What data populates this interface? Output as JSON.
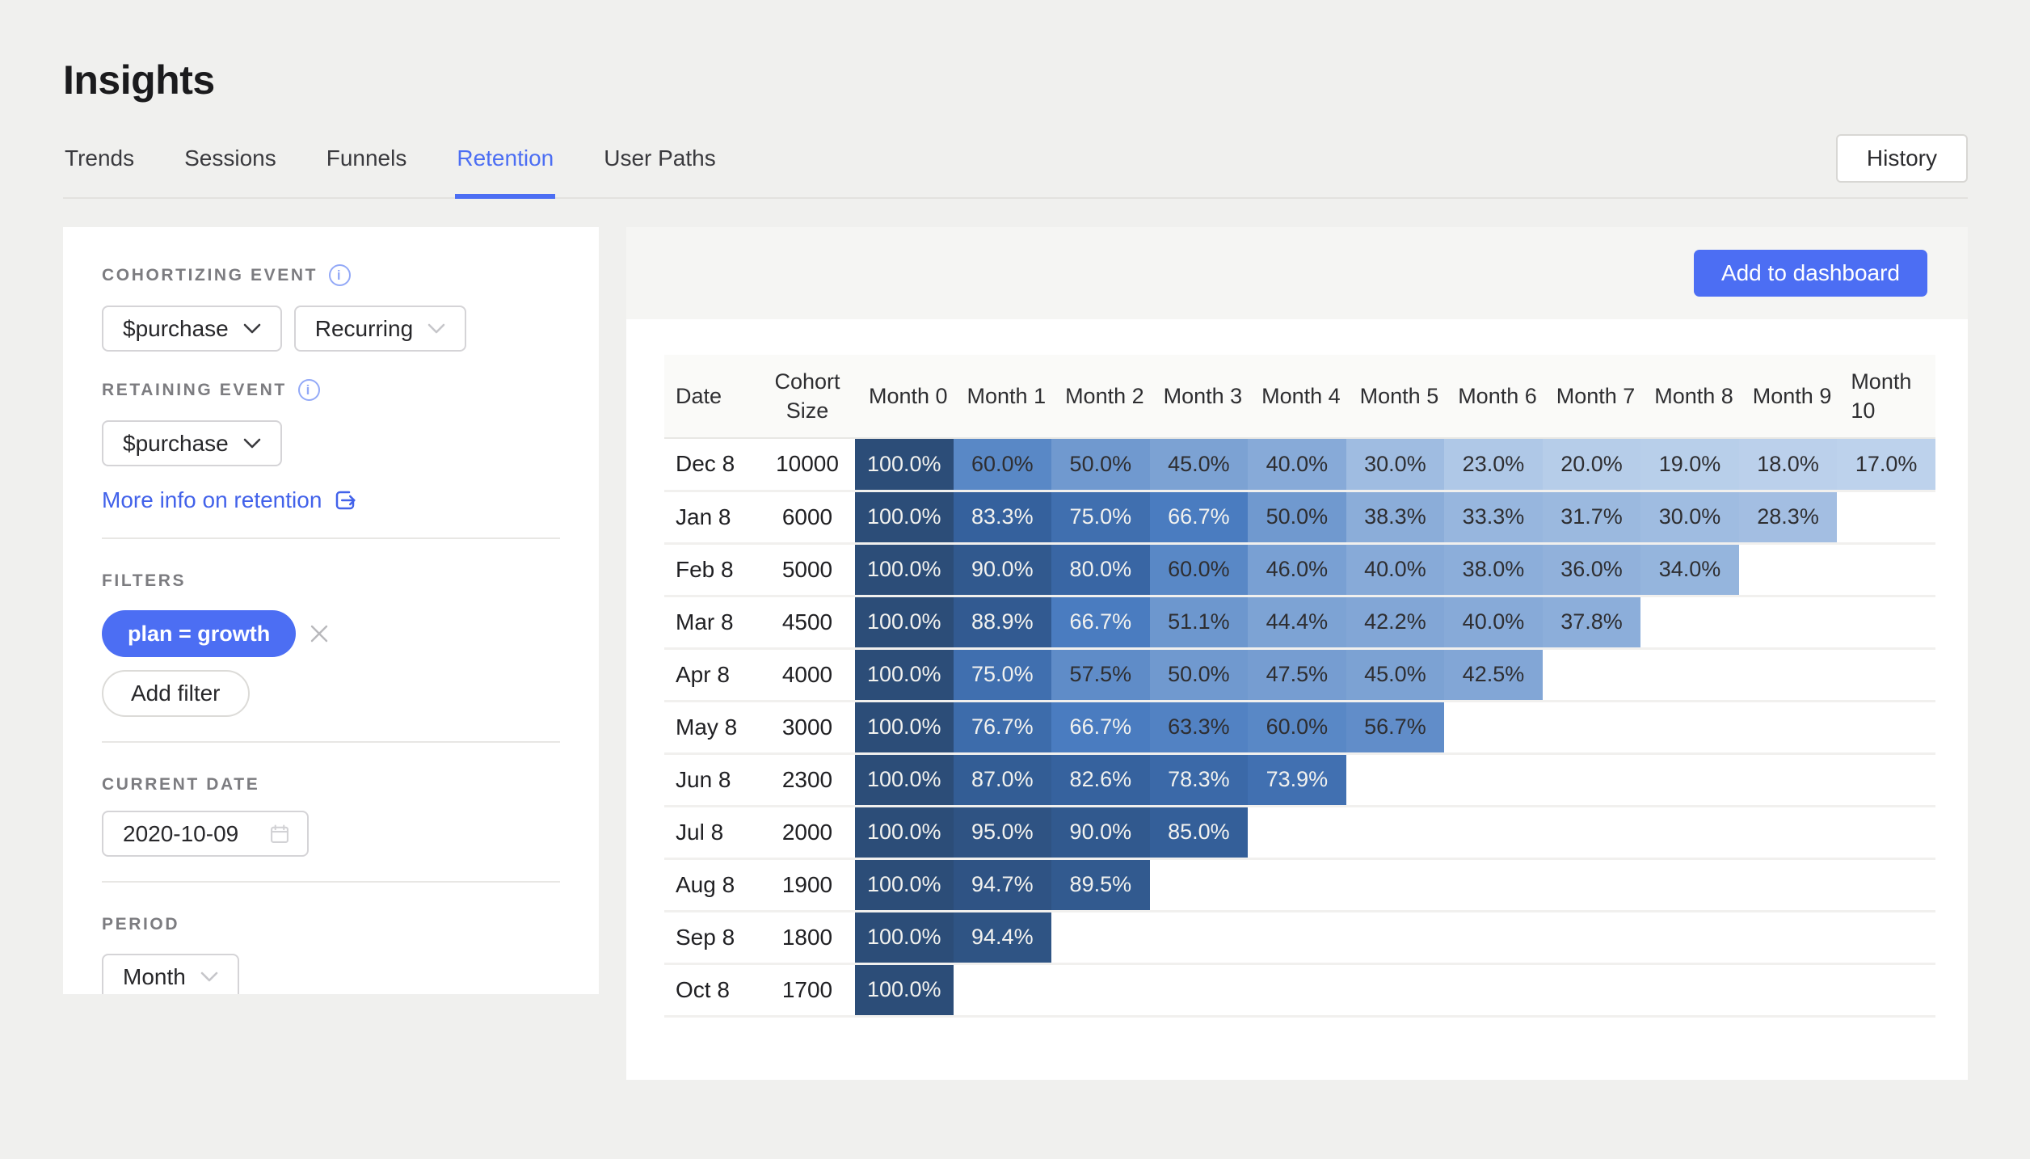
{
  "page": {
    "title": "Insights"
  },
  "tabs": [
    {
      "label": "Trends",
      "active": false
    },
    {
      "label": "Sessions",
      "active": false
    },
    {
      "label": "Funnels",
      "active": false
    },
    {
      "label": "Retention",
      "active": true
    },
    {
      "label": "User Paths",
      "active": false
    }
  ],
  "header": {
    "history_label": "History"
  },
  "sidebar": {
    "cohortizing_event": {
      "label": "COHORTIZING EVENT",
      "event": "$purchase",
      "mode": "Recurring"
    },
    "retaining_event": {
      "label": "RETAINING EVENT",
      "event": "$purchase"
    },
    "more_info_link": "More info on retention",
    "filters": {
      "label": "FILTERS",
      "chips": [
        {
          "text": "plan = growth"
        }
      ],
      "add_label": "Add filter"
    },
    "current_date": {
      "label": "CURRENT DATE",
      "value": "2020-10-09"
    },
    "period": {
      "label": "PERIOD",
      "value": "Month"
    }
  },
  "main": {
    "add_to_dashboard_label": "Add to dashboard",
    "retention_table": {
      "columns": [
        "Date",
        "Cohort Size",
        "Month 0",
        "Month 1",
        "Month 2",
        "Month 3",
        "Month 4",
        "Month 5",
        "Month 6",
        "Month 7",
        "Month 8",
        "Month 9",
        "Month 10"
      ],
      "month_column_count": 11,
      "rows": [
        {
          "date": "Dec 8",
          "cohort_size": 10000,
          "values": [
            100.0,
            60.0,
            50.0,
            45.0,
            40.0,
            30.0,
            23.0,
            20.0,
            19.0,
            18.0,
            17.0
          ]
        },
        {
          "date": "Jan 8",
          "cohort_size": 6000,
          "values": [
            100.0,
            83.3,
            75.0,
            66.7,
            50.0,
            38.3,
            33.3,
            31.7,
            30.0,
            28.3
          ]
        },
        {
          "date": "Feb 8",
          "cohort_size": 5000,
          "values": [
            100.0,
            90.0,
            80.0,
            60.0,
            46.0,
            40.0,
            38.0,
            36.0,
            34.0
          ]
        },
        {
          "date": "Mar 8",
          "cohort_size": 4500,
          "values": [
            100.0,
            88.9,
            66.7,
            51.1,
            44.4,
            42.2,
            40.0,
            37.8
          ]
        },
        {
          "date": "Apr 8",
          "cohort_size": 4000,
          "values": [
            100.0,
            75.0,
            57.5,
            50.0,
            47.5,
            45.0,
            42.5
          ]
        },
        {
          "date": "May 8",
          "cohort_size": 3000,
          "values": [
            100.0,
            76.7,
            66.7,
            63.3,
            60.0,
            56.7
          ]
        },
        {
          "date": "Jun 8",
          "cohort_size": 2300,
          "values": [
            100.0,
            87.0,
            82.6,
            78.3,
            73.9
          ]
        },
        {
          "date": "Jul 8",
          "cohort_size": 2000,
          "values": [
            100.0,
            95.0,
            90.0,
            85.0
          ]
        },
        {
          "date": "Aug 8",
          "cohort_size": 1900,
          "values": [
            100.0,
            94.7,
            89.5
          ]
        },
        {
          "date": "Sep 8",
          "cohort_size": 1800,
          "values": [
            100.0,
            94.4
          ]
        },
        {
          "date": "Oct 8",
          "cohort_size": 1700,
          "values": [
            100.0
          ]
        }
      ],
      "value_suffix": "%"
    },
    "heat_scale": {
      "stops": [
        {
          "v": 17,
          "color": "#bdd2ec"
        },
        {
          "v": 50,
          "color": "#7099cf"
        },
        {
          "v": 66.7,
          "color": "#4a7cc0"
        },
        {
          "v": 83.3,
          "color": "#35619d"
        },
        {
          "v": 100,
          "color": "#2c4d78"
        }
      ],
      "white_text_min": 65
    }
  },
  "colors": {
    "accent": "#4c6ef3",
    "link": "#4262ea",
    "page_background": "#f0f0ee",
    "panel_background": "#ffffff",
    "toolbar_strip": "#f5f5f3",
    "table_header_background": "#fafaf8"
  }
}
